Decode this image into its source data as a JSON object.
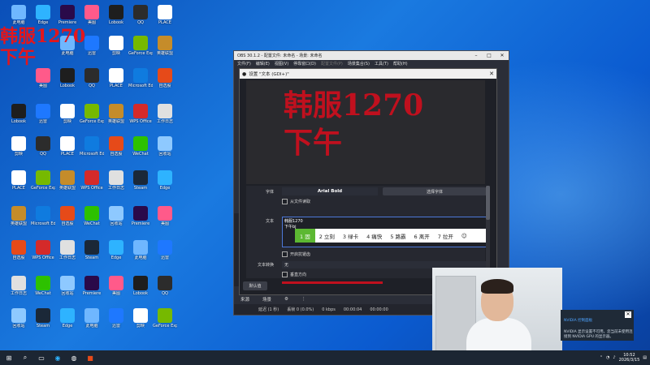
{
  "overlay_text": {
    "line1": "韩服1270",
    "line2": "下午"
  },
  "desktop_icons": [
    {
      "label": "此电脑",
      "color": "#6fb7ff"
    },
    {
      "label": "Lobook",
      "color": "#1e1e1e"
    },
    {
      "label": "剪映",
      "color": "#ffffff"
    },
    {
      "label": "PLACE",
      "color": "#ffffff"
    },
    {
      "label": "英雄联盟",
      "color": "#c58c2a"
    },
    {
      "label": "自选股",
      "color": "#e64a19"
    },
    {
      "label": "工作日志",
      "color": "#e0e0e0"
    },
    {
      "label": "回收站",
      "color": "#8ec9ff"
    },
    {
      "label": "Edge",
      "color": "#2eb3ff"
    },
    {
      "label": "美图",
      "color": "#ff5a8a"
    },
    {
      "label": "迅雷",
      "color": "#1e78ff"
    },
    {
      "label": "QQ",
      "color": "#2c2c2c"
    },
    {
      "label": "GeForce Experience",
      "color": "#76b900"
    },
    {
      "label": "Microsoft Edge",
      "color": "#0f7bdf"
    },
    {
      "label": "WPS Office",
      "color": "#d42a2a"
    },
    {
      "label": "WeChat",
      "color": "#2dc100"
    },
    {
      "label": "Steam",
      "color": "#1b2838"
    },
    {
      "label": "Premiere",
      "color": "#2a0a4a"
    }
  ],
  "obs": {
    "window_title": "OBS 30.1.2 - 配置文件: 未命名 - 场景: 未命名",
    "menu": [
      "文件(F)",
      "编辑(E)",
      "视图(V)",
      "停靠窗口(D)",
      "配置文件(P)",
      "场景集合(S)",
      "工具(T)",
      "帮助(H)"
    ],
    "tabs": [
      "来源",
      "场景"
    ],
    "status": [
      "延迟 (1 秒)",
      "丢帧 0 (0.0%)",
      "0 kbps",
      "00:00:04",
      "00:00:00"
    ]
  },
  "dialog": {
    "title": "设置 \"文本 (GDI+)\"",
    "preview_line1": "韩服1270",
    "preview_line2": "下午",
    "font_label": "字体",
    "font_value": "Arial Bold",
    "select_font_button": "选择字体",
    "read_from_file": "从文件读取",
    "text_label": "文本",
    "text_line1": "韩服1270",
    "text_line2": "下午bj",
    "ime_candidates": [
      "1 固",
      "2 立刻",
      "3 绿卡",
      "4 痛快",
      "5 路霸",
      "6 离开",
      "7 拉开"
    ],
    "antialias": "开启抗锯齿",
    "transform_label": "文本转换",
    "transform_value": "无",
    "vertical": "垂直方向",
    "defaults_button": "默认值"
  },
  "notification": {
    "title": "NVIDIA 控制面板",
    "body": "NVIDIA 显示设置不可用。您当前未使用连接到 NVIDIA GPU 的显示器。"
  },
  "taskbar": {
    "time": "10:52",
    "date": "2026/3/15"
  }
}
